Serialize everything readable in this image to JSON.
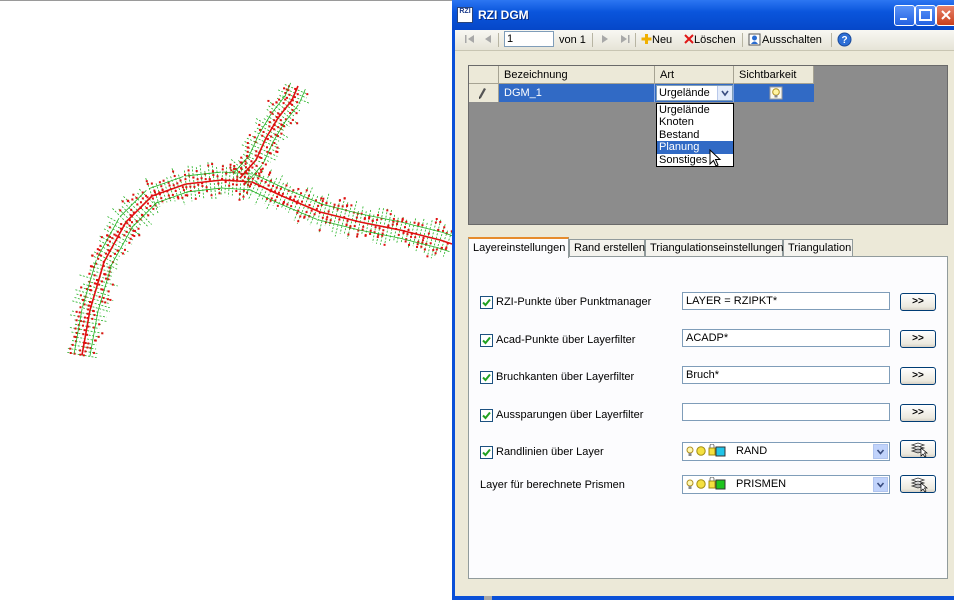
{
  "window": {
    "title": "RZI DGM",
    "icon_text": "RZI"
  },
  "nav": {
    "position": "1",
    "of_label": "von 1",
    "new_label": "Neu",
    "delete_label": "Löschen",
    "toggle_label": "Ausschalten"
  },
  "grid": {
    "columns": [
      "Bezeichnung",
      "Art",
      "Sichtbarkeit"
    ],
    "row": {
      "name": "DGM_1",
      "type": "Urgelände"
    },
    "dropdown_options": [
      "Urgelände",
      "Knoten",
      "Bestand",
      "Planung",
      "Sonstiges"
    ],
    "dropdown_highlight": "Planung"
  },
  "tabs": [
    "Layereinstellungen",
    "Rand erstellen",
    "Triangulationseinstellungen",
    "Triangulation"
  ],
  "active_tab": "Layereinstellungen",
  "settings": {
    "rzi": {
      "label": "RZI-Punkte über Punktmanager",
      "value": "LAYER = RZIPKT*",
      "button": ">>",
      "checked": true
    },
    "acad": {
      "label": "Acad-Punkte über Layerfilter",
      "value": "ACADP*",
      "button": ">>",
      "checked": true
    },
    "bruch": {
      "label": "Bruchkanten über Layerfilter",
      "value": "Bruch*",
      "button": ">>",
      "checked": true
    },
    "ausspar": {
      "label": "Aussparungen über Layerfilter",
      "value": "",
      "button": ">>",
      "checked": true
    },
    "rand": {
      "label": "Randlinien über Layer",
      "layer": "RAND",
      "layer_color": "#21c4e8",
      "checked": true
    },
    "prismen": {
      "label": "Layer für berechnete Prismen",
      "layer": "PRISMEN",
      "layer_color": "#1ec41e"
    }
  },
  "colors": {
    "titlebar": "#0a55dc",
    "selection": "#316ac5",
    "tab_accent": "#e68b2c",
    "survey_points": "#e01010",
    "survey_lines": "#20b020"
  },
  "icons": [
    "pencil-icon",
    "lightbulb-icon",
    "help-icon",
    "add-icon",
    "delete-icon",
    "layer-pick-icon"
  ]
}
